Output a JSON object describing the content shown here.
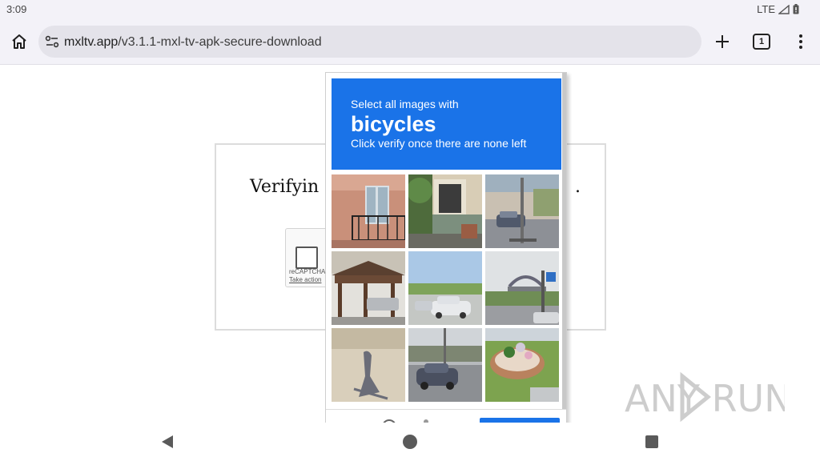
{
  "status_bar": {
    "time": "3:09",
    "network": "LTE"
  },
  "toolbar": {
    "url_host": "mxltv.app",
    "url_path": "/v3.1.1-mxl-tv-apk-secure-download",
    "tab_count": "1"
  },
  "page": {
    "verify_text": "Verifyin",
    "verify_suffix": ".",
    "recaptcha_brand": "reCAPTCHA",
    "recaptcha_privacy": "Take action"
  },
  "challenge": {
    "line1": "Select all images with",
    "target": "bicycles",
    "line3": "Click verify once there are none left",
    "tiles": [
      "tile-1",
      "tile-2",
      "tile-3",
      "tile-4",
      "tile-5",
      "tile-6",
      "tile-7",
      "tile-8",
      "tile-9"
    ]
  },
  "watermark": {
    "text": "ANY RUN"
  },
  "colors": {
    "accent": "#1a73e8",
    "chrome": "#f3f2f8"
  }
}
